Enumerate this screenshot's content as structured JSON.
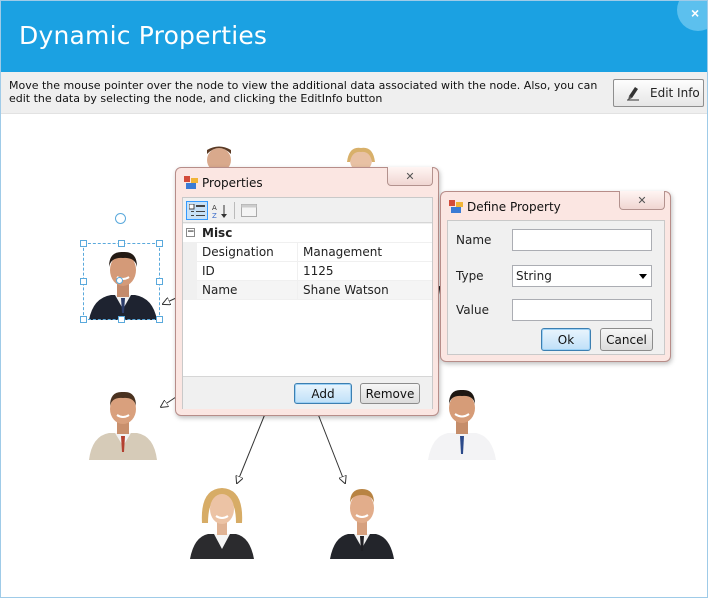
{
  "window": {
    "title": "Dynamic Properties",
    "close_glyph": "×"
  },
  "infobar": {
    "description": "Move the mouse pointer over the node to view the additional data associated with the node. Also,  you can edit the data by selecting the node, and clicking the EditInfo button",
    "edit_button_label": "Edit Info",
    "edit_button_icon": "pencil-icon"
  },
  "diagram": {
    "nodes": [
      {
        "id": "top-center-left",
        "role": "partially hidden employee"
      },
      {
        "id": "top-center-right",
        "role": "partially hidden employee"
      },
      {
        "id": "selected",
        "role": "Shane Watson"
      },
      {
        "id": "left",
        "role": "employee"
      },
      {
        "id": "right",
        "role": "employee"
      },
      {
        "id": "bottom-left",
        "role": "employee"
      },
      {
        "id": "bottom-right",
        "role": "employee"
      }
    ]
  },
  "properties_dialog": {
    "title": "Properties",
    "close_glyph": "✕",
    "toolbar": {
      "categorized_icon": "categorized-icon",
      "alphabetical_icon": "sort-az-icon",
      "pages_icon": "property-pages-icon"
    },
    "category": {
      "label": "Misc",
      "toggle": "−"
    },
    "rows": [
      {
        "name": "Designation",
        "value": "Management"
      },
      {
        "name": "ID",
        "value": "1125"
      },
      {
        "name": "Name",
        "value": "Shane Watson"
      }
    ],
    "add_label": "Add",
    "remove_label": "Remove"
  },
  "define_property_dialog": {
    "title": "Define Property",
    "close_glyph": "✕",
    "name_label": "Name",
    "name_value": "",
    "type_label": "Type",
    "type_value": "String",
    "value_label": "Value",
    "value_value": "",
    "ok_label": "Ok",
    "cancel_label": "Cancel"
  },
  "colors": {
    "titlebar": "#1ba1e2",
    "dialog_bg": "#fbe6e2",
    "selection": "#5aa9dc"
  }
}
